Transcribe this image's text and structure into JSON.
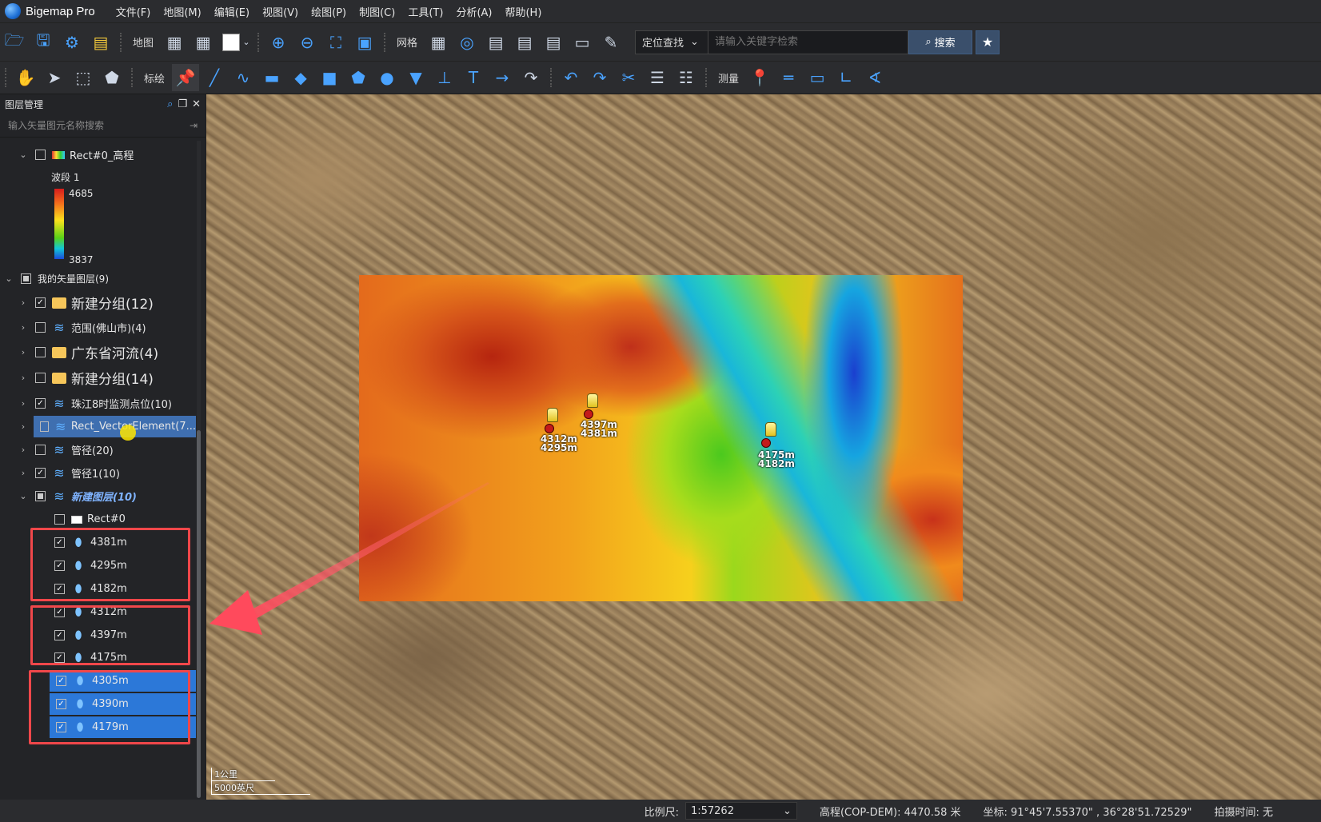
{
  "app": {
    "title": "Bigemap Pro"
  },
  "menu": [
    "文件(F)",
    "地图(M)",
    "编辑(E)",
    "视图(V)",
    "绘图(P)",
    "制图(C)",
    "工具(T)",
    "分析(A)",
    "帮助(H)"
  ],
  "toolbar1": {
    "map_label": "地图",
    "grid_label": "网格",
    "search": {
      "mode": "定位查找",
      "placeholder": "请输入关键字检索",
      "button": "搜索"
    }
  },
  "toolbar2": {
    "annotate_label": "标绘",
    "measure_label": "测量"
  },
  "panel": {
    "title": "图层管理",
    "search_placeholder": "输入矢量图元名称搜索",
    "raster": {
      "name": "Rect#0_高程",
      "band": "波段 1",
      "max": "4685",
      "min": "3837"
    },
    "vector_root": "我的矢量图层(9)",
    "items": [
      {
        "label": "新建分组(12)"
      },
      {
        "label": "范围(佛山市)(4)"
      },
      {
        "label": "广东省河流(4)"
      },
      {
        "label": "新建分组(14)"
      },
      {
        "label": "珠江8时监测点位(10)"
      },
      {
        "label": "Rect_VectorElement(7..."
      },
      {
        "label": "管径(20)"
      },
      {
        "label": "管径1(10)"
      },
      {
        "label": "新建图层(10)"
      }
    ],
    "children": [
      {
        "label": "Rect#0"
      },
      {
        "label": "4381m"
      },
      {
        "label": "4295m"
      },
      {
        "label": "4182m"
      },
      {
        "label": "4312m"
      },
      {
        "label": "4397m"
      },
      {
        "label": "4175m"
      },
      {
        "label": "4305m"
      },
      {
        "label": "4390m"
      },
      {
        "label": "4179m"
      }
    ]
  },
  "map": {
    "markers": [
      {
        "a": "4312m",
        "b": "4295m"
      },
      {
        "a": "4397m",
        "b": "4381m"
      },
      {
        "a": "4175m",
        "b": "4182m"
      }
    ],
    "scale_km": "1公里",
    "scale_ft": "5000英尺"
  },
  "status": {
    "scale_label": "比例尺:",
    "scale_value": "1:57262",
    "elevation": "高程(COP-DEM): 4470.58 米",
    "coords": "坐标: 91°45'7.55370\" , 36°28'51.72529\"",
    "capture_time": "拍摄时间: 无"
  }
}
